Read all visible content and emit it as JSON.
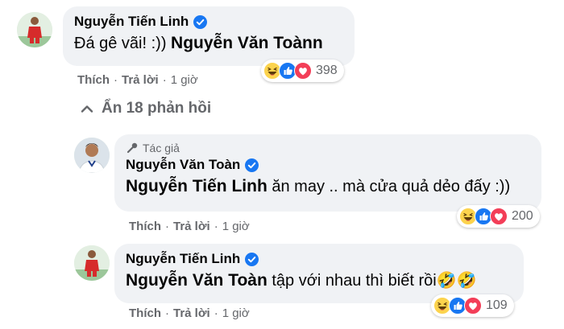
{
  "comments": [
    {
      "name": "Nguyễn Tiến Linh",
      "text_prefix": "Đá gê vãi! :)) ",
      "mention": "Nguyễn Văn Toàn",
      "text_suffix": "n",
      "actions": {
        "like": "Thích",
        "reply": "Trả lời",
        "sep": "·",
        "time": "1 giờ"
      },
      "reactions": {
        "icons": [
          "haha-icon",
          "like-icon",
          "love-icon"
        ],
        "count": "398"
      }
    },
    {
      "author_label": "Tác giả",
      "name": "Nguyễn Văn Toàn",
      "mention": "Nguyễn Tiến Linh",
      "text": " ăn may .. mà cửa quả dẻo đấy :))",
      "actions": {
        "like": "Thích",
        "reply": "Trả lời",
        "sep": "·",
        "time": "1 giờ"
      },
      "reactions": {
        "icons": [
          "haha-icon",
          "like-icon",
          "love-icon"
        ],
        "count": "200"
      }
    },
    {
      "name": "Nguyễn Tiến Linh",
      "mention": "Nguyễn Văn Toàn",
      "text": " tập với nhau thì biết rồi",
      "emoji_suffix": "🤣🤣",
      "actions": {
        "like": "Thích",
        "reply": "Trả lời",
        "sep": "·",
        "time": "1 giờ"
      },
      "reactions": {
        "icons": [
          "haha-icon",
          "like-icon",
          "love-icon"
        ],
        "count": "109"
      }
    }
  ],
  "replies_toggle": {
    "label": "Ẩn 18 phản hồi",
    "icon": "chevron-up-icon"
  },
  "colors": {
    "bubble": "#f0f2f5",
    "verified": "#1877f2",
    "meta": "#65676b",
    "jersey": "#d62b2b"
  }
}
